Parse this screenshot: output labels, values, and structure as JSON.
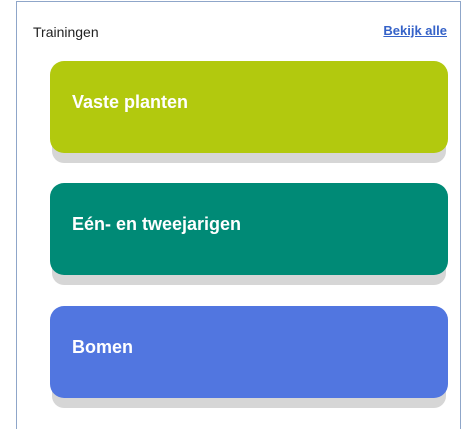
{
  "header": {
    "title": "Trainingen",
    "view_all_label": "Bekijk alle"
  },
  "cards": [
    {
      "label": "Vaste planten",
      "color": "#b2c90e"
    },
    {
      "label": "Eén- en tweejarigen",
      "color": "#008a76"
    },
    {
      "label": "Bomen",
      "color": "#5176e0"
    }
  ]
}
